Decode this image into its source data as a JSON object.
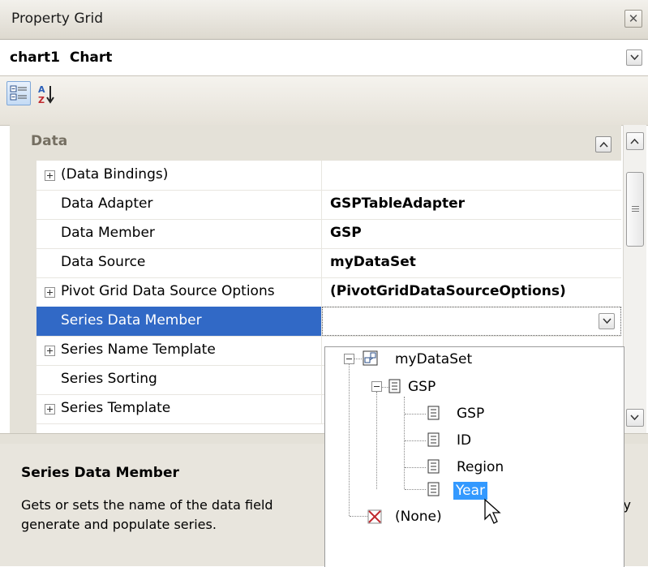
{
  "window": {
    "title": "Property Grid"
  },
  "object_selector": {
    "name": "chart1",
    "type": "Chart"
  },
  "toolbar": {
    "categorized_icon": "categorized-icon",
    "alphabetical_icon": "sort-alphabetical-icon"
  },
  "grid": {
    "category": "Data",
    "rows": [
      {
        "name": "(Data Bindings)",
        "value": "",
        "expandable": true
      },
      {
        "name": "Data Adapter",
        "value": "GSPTableAdapter",
        "expandable": false
      },
      {
        "name": "Data Member",
        "value": "GSP",
        "expandable": false
      },
      {
        "name": "Data Source",
        "value": "myDataSet",
        "expandable": false
      },
      {
        "name": "Pivot Grid Data Source Options",
        "value": "(PivotGridDataSourceOptions)",
        "expandable": true
      },
      {
        "name": "Series Data Member",
        "value": "",
        "expandable": false,
        "selected": true
      },
      {
        "name": "Series Name Template",
        "value": "",
        "expandable": true
      },
      {
        "name": "Series Sorting",
        "value": "",
        "expandable": false
      },
      {
        "name": "Series Template",
        "value": "",
        "expandable": true
      }
    ]
  },
  "dropdown_tree": {
    "root": "myDataSet",
    "table": "GSP",
    "fields": [
      "GSP",
      "ID",
      "Region",
      "Year"
    ],
    "selected_field": "Year",
    "none_option": "(None)"
  },
  "description": {
    "title": "Series Data Member",
    "line1_left": "Gets or sets the name of the data field",
    "line1_right": "ly",
    "line2": "generate and populate series."
  },
  "colors": {
    "selection": "#3169c6",
    "tree_highlight": "#3399ff",
    "category_text": "#756f62"
  }
}
